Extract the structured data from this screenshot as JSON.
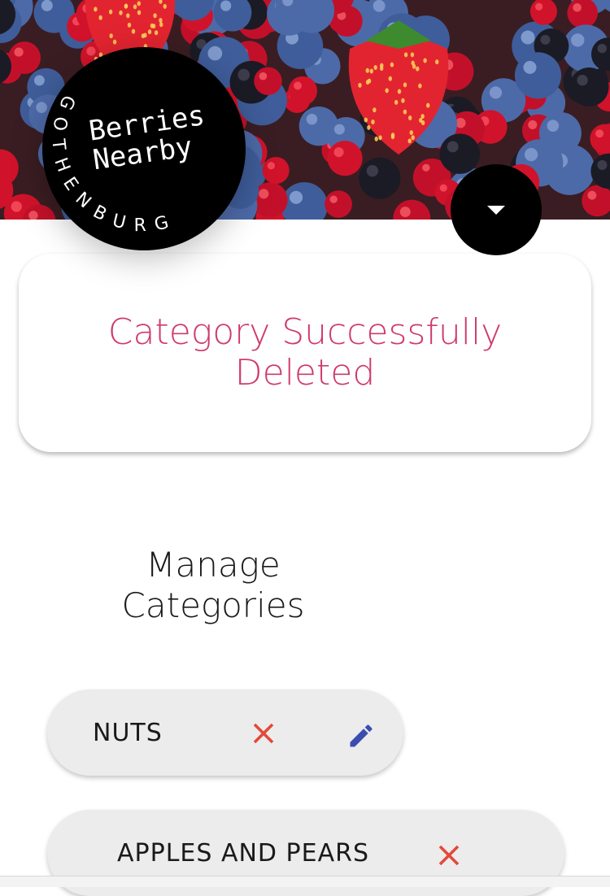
{
  "brand": {
    "name_line1": "Berries",
    "name_line2": "Nearby",
    "city": "GOTHENBURG"
  },
  "header": {
    "menu_icon": "caret-down-icon"
  },
  "notice": {
    "message": "Category Successfully Deleted",
    "color": "#cf3a6e"
  },
  "section": {
    "title": "Manage Categories"
  },
  "categories": [
    {
      "label": "NUTS",
      "delete_icon": "close-icon",
      "edit_icon": "pencil-icon"
    },
    {
      "label": "APPLES AND PEARS",
      "delete_icon": "close-icon"
    }
  ],
  "colors": {
    "delete": "#e2493a",
    "edit": "#3b4eb0",
    "chip_bg": "#ececec"
  }
}
